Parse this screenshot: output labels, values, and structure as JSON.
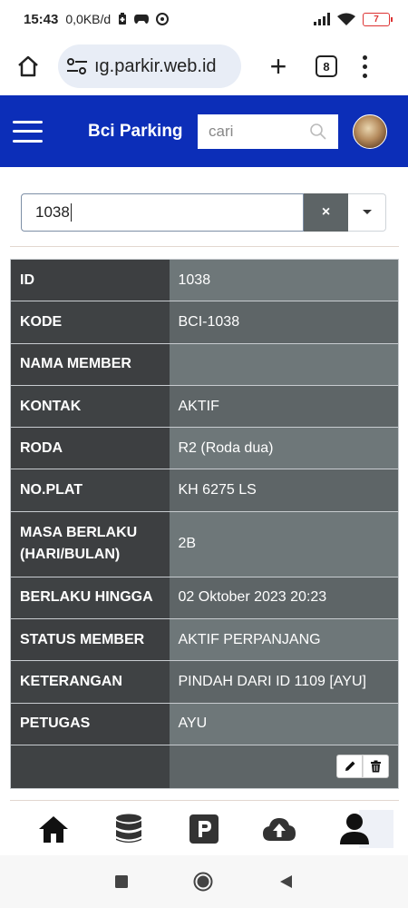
{
  "status_bar": {
    "time": "15:43",
    "net_speed": "0,0KB/d",
    "battery": "7"
  },
  "browser": {
    "url": "ıg.parkir.web.id",
    "tab_count": "8"
  },
  "header": {
    "title": "Bci Parking",
    "search_placeholder": "cari"
  },
  "selector": {
    "value": "1038",
    "clear_label": "×"
  },
  "detail": {
    "rows": [
      {
        "label": "ID",
        "value": "1038"
      },
      {
        "label": "KODE",
        "value": "BCI-1038"
      },
      {
        "label": "NAMA MEMBER",
        "value": ""
      },
      {
        "label": "KONTAK",
        "value": "AKTIF"
      },
      {
        "label": "RODA",
        "value": "R2 (Roda dua)"
      },
      {
        "label": "NO.PLAT",
        "value": "KH 6275 LS"
      },
      {
        "label": "MASA BERLAKU (HARI/BULAN)",
        "value": "2B"
      },
      {
        "label": "BERLAKU HINGGA",
        "value": "02 Oktober 2023 20:23"
      },
      {
        "label": "STATUS MEMBER",
        "value": "AKTIF PERPANJANG"
      },
      {
        "label": "KETERANGAN",
        "value": "PINDAH DARI ID 1109 [AYU]"
      },
      {
        "label": "PETUGAS",
        "value": "AYU"
      }
    ]
  },
  "colors": {
    "header_bg": "#0c2eb8",
    "label_bg": "#3d3f41",
    "value_bg": "#6b7476"
  },
  "bottom_nav": [
    "home-icon",
    "database-icon",
    "parking-icon",
    "cloud-upload-icon",
    "user-icon"
  ]
}
